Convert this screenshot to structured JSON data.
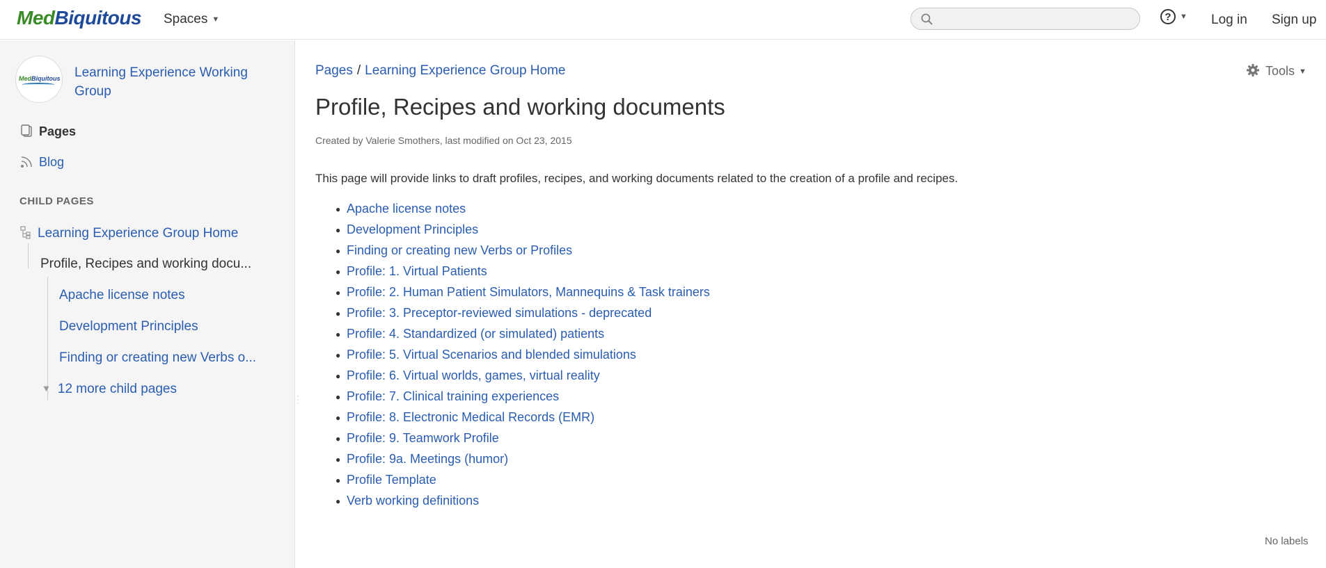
{
  "header": {
    "logo_part1": "Med",
    "logo_part2": "Biquitous",
    "spaces_label": "Spaces",
    "search_placeholder": "",
    "help_symbol": "?",
    "login_label": "Log in",
    "signup_label": "Sign up"
  },
  "sidebar": {
    "space_logo_text1": "Med",
    "space_logo_text2": "Biquitous",
    "space_name": "Learning Experience Working Group",
    "nav": {
      "pages": "Pages",
      "blog": "Blog"
    },
    "child_pages_heading": "CHILD PAGES",
    "tree": {
      "home": "Learning Experience Group Home",
      "current": "Profile, Recipes and working docu...",
      "children": [
        "Apache license notes",
        "Development Principles",
        "Finding or creating new Verbs o..."
      ],
      "more": "12 more child pages"
    }
  },
  "main": {
    "breadcrumb": {
      "root": "Pages",
      "separator": "/",
      "parent": "Learning Experience Group Home"
    },
    "tools_label": "Tools",
    "title": "Profile, Recipes and working documents",
    "meta": "Created by Valerie Smothers, last modified on Oct 23, 2015",
    "intro": "This page will provide links to draft profiles, recipes, and working documents related to the creation of a profile and recipes.",
    "links": [
      "Apache license notes",
      "Development Principles",
      "Finding or creating new Verbs or Profiles",
      "Profile: 1. Virtual Patients",
      "Profile: 2. Human Patient Simulators, Mannequins & Task trainers",
      "Profile: 3. Preceptor-reviewed simulations - deprecated",
      "Profile: 4. Standardized (or simulated) patients",
      "Profile: 5. Virtual Scenarios and blended simulations",
      "Profile: 6. Virtual worlds, games, virtual reality",
      "Profile: 7. Clinical training experiences",
      "Profile: 8. Electronic Medical Records (EMR)",
      "Profile: 9. Teamwork Profile",
      "Profile: 9a. Meetings (humor)",
      "Profile Template",
      "Verb working definitions"
    ],
    "labels_text": "No labels"
  },
  "colors": {
    "logo_green": "#3a8a28",
    "logo_blue": "#1f4a99",
    "link": "#2a5db0",
    "sidebar_bg": "#f5f5f5"
  },
  "icons": [
    "search-icon",
    "help-icon",
    "pages-icon",
    "blog-icon",
    "page-tree-icon",
    "chevron-down-icon",
    "gear-icon"
  ]
}
